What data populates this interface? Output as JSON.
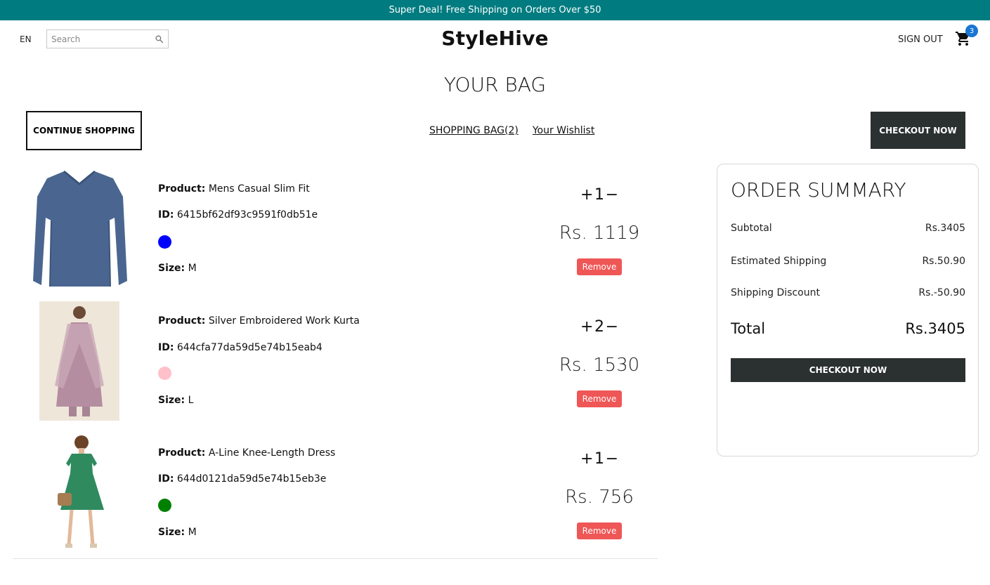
{
  "announcement": "Super Deal! Free Shipping on Orders Over $50",
  "nav": {
    "lang": "EN",
    "search_placeholder": "Search",
    "logo": "StyleHive",
    "signout": "SIGN OUT",
    "cart_count": "3"
  },
  "page": {
    "title": "YOUR BAG",
    "continue_label": "CONTINUE SHOPPING",
    "bag_link": "SHOPPING BAG(2)",
    "wishlist_link": "Your Wishlist",
    "checkout_label": "CHECKOUT NOW"
  },
  "products": [
    {
      "product_label": "Product:",
      "name": "Mens Casual Slim Fit",
      "id_label": "ID:",
      "id": "6415bf62df93c9591f0db51e",
      "color": "#0000ff",
      "size_label": "Size:",
      "size": "M",
      "plus": "+",
      "qty": "1",
      "minus": "−",
      "price": "Rs. 1119",
      "remove": "Remove"
    },
    {
      "product_label": "Product:",
      "name": "Silver Embroidered Work Kurta",
      "id_label": "ID:",
      "id": "644cfa77da59d5e74b15eab4",
      "color": "#ffc0cb",
      "size_label": "Size:",
      "size": "L",
      "plus": "+",
      "qty": "2",
      "minus": "−",
      "price": "Rs. 1530",
      "remove": "Remove"
    },
    {
      "product_label": "Product:",
      "name": "A-Line Knee-Length Dress",
      "id_label": "ID:",
      "id": "644d0121da59d5e74b15eb3e",
      "color": "#008000",
      "size_label": "Size:",
      "size": "M",
      "plus": "+",
      "qty": "1",
      "minus": "−",
      "price": "Rs. 756",
      "remove": "Remove"
    }
  ],
  "summary": {
    "title": "ORDER SUMMARY",
    "subtotal_label": "Subtotal",
    "subtotal": "Rs.3405",
    "shipping_label": "Estimated Shipping",
    "shipping": "Rs.50.90",
    "discount_label": "Shipping Discount",
    "discount": "Rs.-50.90",
    "total_label": "Total",
    "total": "Rs.3405",
    "checkout_label": "CHECKOUT NOW"
  },
  "colors": {
    "announcement_bg": "#007c80",
    "dark_button": "#2b3030",
    "remove_button": "#ef5656",
    "badge": "#1976d2"
  }
}
